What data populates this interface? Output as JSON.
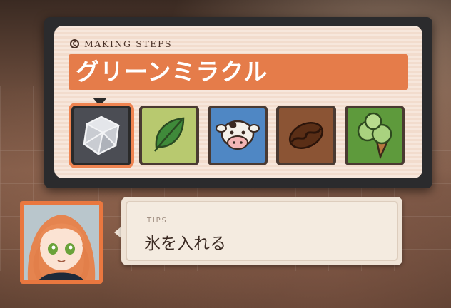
{
  "steps_panel": {
    "header_label": "MAKING STEPS",
    "title": "グリーンミラクル",
    "selected_index": 0,
    "steps": [
      {
        "name": "ice",
        "icon": "ice-cube-icon"
      },
      {
        "name": "leaf",
        "icon": "leaf-icon"
      },
      {
        "name": "milk",
        "icon": "cow-icon"
      },
      {
        "name": "coffee",
        "icon": "coffee-bean-icon"
      },
      {
        "name": "ice-cream",
        "icon": "ice-cream-icon"
      }
    ]
  },
  "tips": {
    "label": "TIPS",
    "text": "氷を入れる"
  },
  "colors": {
    "accent_orange": "#e57c4a",
    "panel_bg": "#f7e7dc",
    "frame_dark": "#2b2b2d"
  }
}
